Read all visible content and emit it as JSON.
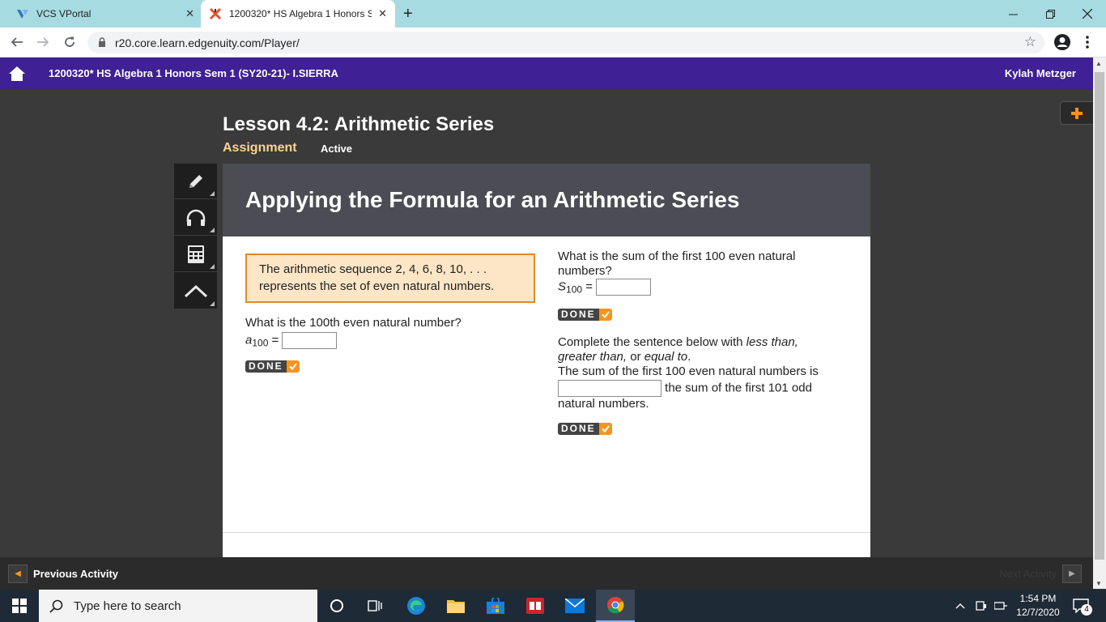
{
  "browser": {
    "tabs": [
      {
        "title": "VCS VPortal",
        "close": "✕"
      },
      {
        "title": "1200320* HS Algebra 1 Honors S",
        "close": "✕"
      }
    ],
    "new_tab": "+",
    "url": "r20.core.learn.edgenuity.com/Player/"
  },
  "header": {
    "course_title": "1200320* HS Algebra 1 Honors Sem 1 (SY20-21)- I.SIERRA",
    "user_name": "Kylah Metzger"
  },
  "lesson": {
    "title": "Lesson 4.2: Arithmetic Series",
    "type": "Assignment",
    "status": "Active"
  },
  "tools": [
    "pencil-icon",
    "headphones-icon",
    "calculator-icon",
    "caret-up-icon"
  ],
  "content": {
    "heading": "Applying the Formula for an Arithmetic Series",
    "info_line1": "The arithmetic sequence 2, 4, 6, 8, 10, . . .",
    "info_line2": "represents the set of even natural numbers.",
    "q1": {
      "prompt": "What is the 100th even natural number?",
      "var": "a",
      "sub": "100",
      "eq": " =",
      "value": ""
    },
    "q2": {
      "prompt_line1": "What is the sum of the first 100 even natural",
      "prompt_line2": "numbers?",
      "var": "S",
      "sub": "100",
      "eq": " =",
      "value": ""
    },
    "q3": {
      "intro_pre": "Complete the sentence below with ",
      "opt1": "less than,",
      "opt2": "greater than,",
      "or": " or ",
      "opt3": "equal to",
      "period": ".",
      "sentence_start": "The sum of the first 100 even natural numbers is",
      "sentence_end": " the sum of the first 101 odd",
      "sentence_end2": "natural numbers.",
      "value": ""
    },
    "done_label": "DONE"
  },
  "activity_nav": {
    "previous": "Previous Activity",
    "next": "Next Activity"
  },
  "taskbar": {
    "search_placeholder": "Type here to search",
    "time": "1:54 PM",
    "date": "12/7/2020",
    "notifications": "4"
  },
  "colors": {
    "header": "#3f2095",
    "accent": "#f7941d",
    "info_bg": "#fde6c6",
    "tabbar": "#a6dbe1"
  }
}
